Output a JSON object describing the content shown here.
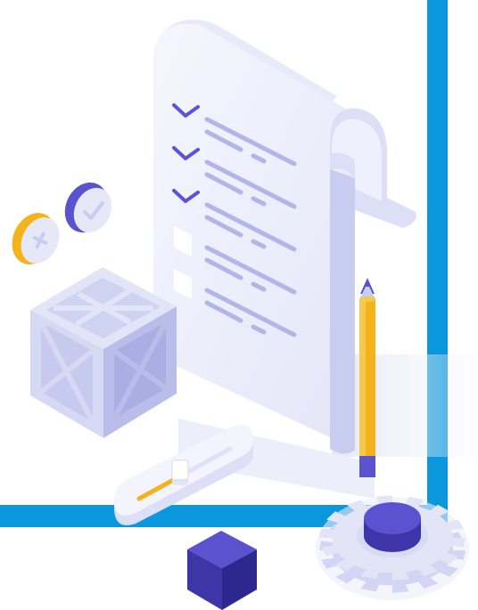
{
  "illustration": {
    "colors": {
      "frame_blue": "#0a97db",
      "paper": "#eef0fb",
      "paper_shade": "#dcdff6",
      "paper_edge": "#c9cdf0",
      "check_stroke": "#5b54d6",
      "text_lines": "#b1b5ea",
      "accent_orange": "#f2b31b",
      "accent_purple": "#5a52cf",
      "dark_purple": "#3e36a8",
      "gear": "#e3e5f7",
      "crate": "#cdd1f1"
    },
    "checklist": {
      "items": [
        {
          "checked": true
        },
        {
          "checked": true
        },
        {
          "checked": true
        },
        {
          "checked": false
        },
        {
          "checked": false
        }
      ]
    },
    "icons": [
      "document-checklist-icon",
      "pencil-icon",
      "gear-icon",
      "crate-icon",
      "cube-icon",
      "slider-icon",
      "plus-coin-icon",
      "check-coin-icon"
    ],
    "slider": {
      "level": 0.45
    }
  }
}
